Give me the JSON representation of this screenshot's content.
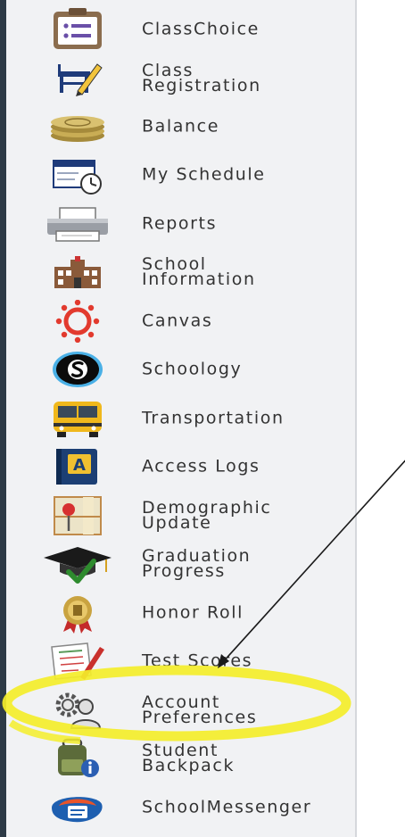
{
  "nav": {
    "items": [
      {
        "label": "ClassChoice",
        "icon": "clipboard-list-icon"
      },
      {
        "label": "Class\nRegistration",
        "icon": "desk-pencil-icon"
      },
      {
        "label": "Balance",
        "icon": "coin-stack-icon"
      },
      {
        "label": "My Schedule",
        "icon": "calendar-clock-icon"
      },
      {
        "label": "Reports",
        "icon": "printer-icon"
      },
      {
        "label": "School\nInformation",
        "icon": "school-building-icon"
      },
      {
        "label": "Canvas",
        "icon": "canvas-logo-icon"
      },
      {
        "label": "Schoology",
        "icon": "schoology-logo-icon"
      },
      {
        "label": "Transportation",
        "icon": "school-bus-icon"
      },
      {
        "label": "Access Logs",
        "icon": "access-logs-book-icon"
      },
      {
        "label": "Demographic\nUpdate",
        "icon": "map-pin-icon"
      },
      {
        "label": "Graduation\nProgress",
        "icon": "graduation-cap-icon"
      },
      {
        "label": "Honor Roll",
        "icon": "honor-medal-icon"
      },
      {
        "label": "Test Scores",
        "icon": "test-paper-icon"
      },
      {
        "label": "Account\nPreferences",
        "icon": "gear-user-icon"
      },
      {
        "label": "Student\nBackpack",
        "icon": "backpack-info-icon"
      },
      {
        "label": "SchoolMessenger",
        "icon": "schoolmessenger-logo-icon"
      }
    ]
  },
  "colors": {
    "sidebar_bg": "#f1f2f4",
    "left_bar": "#2d3a46",
    "label_text": "#333333",
    "highlight": "#f4ee2a",
    "arrow": "#1a1a1a"
  }
}
